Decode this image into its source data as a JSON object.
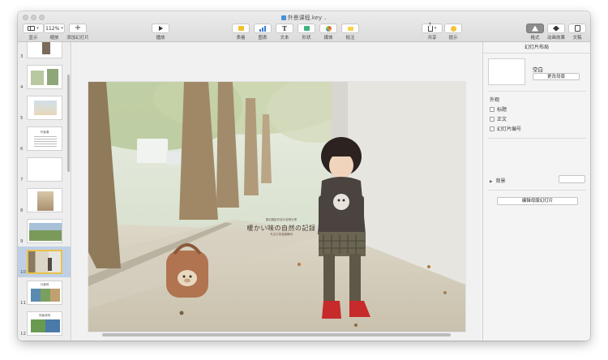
{
  "window": {
    "title": "外景课程.key",
    "title_chevron": "⌄"
  },
  "toolbar": {
    "left": [
      {
        "name": "view",
        "label": "显示"
      },
      {
        "name": "zoom",
        "value": "112%",
        "label": "缩放"
      },
      {
        "name": "add-slide",
        "label": "添加幻灯片"
      }
    ],
    "play": {
      "label": "播放"
    },
    "insert": [
      {
        "name": "table",
        "label": "表格"
      },
      {
        "name": "chart",
        "label": "图表"
      },
      {
        "name": "text",
        "label": "文本",
        "glyph": "T"
      },
      {
        "name": "shape",
        "label": "形状"
      },
      {
        "name": "media",
        "label": "媒体"
      },
      {
        "name": "comment",
        "label": "批注"
      }
    ],
    "share": {
      "label": "共享"
    },
    "tips": {
      "label": "提示"
    },
    "panels": [
      {
        "name": "format",
        "label": "格式",
        "active": true
      },
      {
        "name": "animate",
        "label": "动画效果",
        "active": false
      },
      {
        "name": "document",
        "label": "文稿",
        "active": false
      }
    ]
  },
  "navigator": {
    "slides": [
      {
        "number": "3",
        "kind": "photo-small",
        "selected": false
      },
      {
        "number": "4",
        "kind": "photo-doc",
        "selected": false
      },
      {
        "number": "5",
        "kind": "photo-beach",
        "selected": false
      },
      {
        "number": "6",
        "kind": "text",
        "caption": "外景课",
        "selected": false
      },
      {
        "number": "7",
        "kind": "blank",
        "selected": false
      },
      {
        "number": "8",
        "kind": "photo-child",
        "selected": false
      },
      {
        "number": "9",
        "kind": "photo-landscape",
        "selected": false
      },
      {
        "number": "10",
        "kind": "photo-current",
        "selected": true
      },
      {
        "number": "11",
        "kind": "photo-grid",
        "caption": "分景别",
        "selected": false
      },
      {
        "number": "12",
        "kind": "photo-grid2",
        "caption": "场景说明",
        "selected": false
      }
    ]
  },
  "slide": {
    "pretitle": "原创摄影作品与说明分享",
    "title": "暖かい味の自然の記録",
    "subtitle": "专注记录温暖瞬间"
  },
  "inspector": {
    "header": "幻灯片布局",
    "master_name": "空白",
    "change_master": "更改母版",
    "appearance": "外观",
    "options": [
      {
        "label": "标题",
        "checked": false
      },
      {
        "label": "正文",
        "checked": false
      },
      {
        "label": "幻灯片编号",
        "checked": false
      }
    ],
    "background": "背景",
    "edit_master": "编辑母版幻灯片"
  }
}
